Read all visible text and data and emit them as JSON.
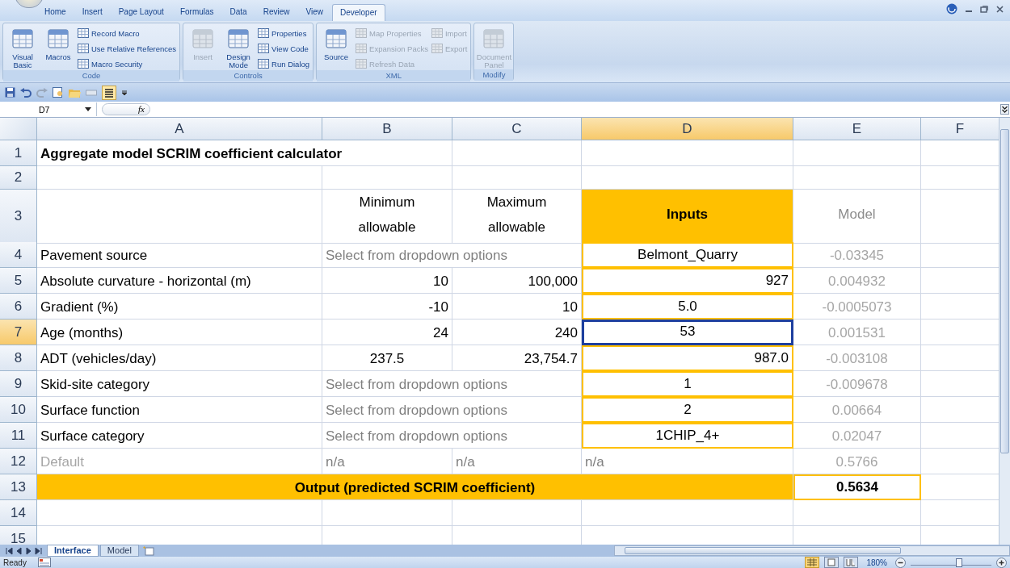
{
  "ribbon_tabs": [
    {
      "label": "Home",
      "selected": false
    },
    {
      "label": "Insert",
      "selected": false
    },
    {
      "label": "Page Layout",
      "selected": false
    },
    {
      "label": "Formulas",
      "selected": false
    },
    {
      "label": "Data",
      "selected": false
    },
    {
      "label": "Review",
      "selected": false
    },
    {
      "label": "View",
      "selected": false
    },
    {
      "label": "Developer",
      "selected": true
    }
  ],
  "ribbon_groups": [
    {
      "name": "Code",
      "items": [
        {
          "kind": "large",
          "label": "Visual Basic",
          "disabled": false
        },
        {
          "kind": "large",
          "label": "Macros",
          "disabled": false
        },
        {
          "kind": "small",
          "label": "Record Macro",
          "disabled": false
        },
        {
          "kind": "small",
          "label": "Use Relative References",
          "disabled": false
        },
        {
          "kind": "small",
          "label": "Macro Security",
          "disabled": false
        }
      ]
    },
    {
      "name": "Controls",
      "items": [
        {
          "kind": "large",
          "label": "Insert",
          "disabled": true
        },
        {
          "kind": "large",
          "label": "Design Mode",
          "disabled": false
        },
        {
          "kind": "small",
          "label": "Properties",
          "disabled": false
        },
        {
          "kind": "small",
          "label": "View Code",
          "disabled": false
        },
        {
          "kind": "small",
          "label": "Run Dialog",
          "disabled": false
        }
      ]
    },
    {
      "name": "XML",
      "items": [
        {
          "kind": "large",
          "label": "Source",
          "disabled": false
        },
        {
          "kind": "small",
          "label": "Map Properties",
          "disabled": true
        },
        {
          "kind": "small",
          "label": "Expansion Packs",
          "disabled": true
        },
        {
          "kind": "small",
          "label": "Refresh Data",
          "disabled": true
        },
        {
          "kind": "small",
          "label": "Import",
          "disabled": true
        },
        {
          "kind": "small",
          "label": "Export",
          "disabled": true
        }
      ]
    },
    {
      "name": "Modify",
      "items": [
        {
          "kind": "large",
          "label": "Document Panel",
          "disabled": true
        }
      ]
    }
  ],
  "formula_bar": {
    "name_box": "D7",
    "fx": "fx"
  },
  "columns": [
    {
      "label": "A",
      "selected": false
    },
    {
      "label": "B",
      "selected": false
    },
    {
      "label": "C",
      "selected": false
    },
    {
      "label": "D",
      "selected": true
    },
    {
      "label": "E",
      "selected": false
    },
    {
      "label": "F",
      "selected": false
    }
  ],
  "rows": [
    {
      "header": "1",
      "selected": false,
      "cells": {
        "A": {
          "kind": "title",
          "text": "Aggregate model SCRIM coefficient calculator",
          "selected": false
        }
      }
    },
    {
      "header": "2",
      "selected": false,
      "cells": {}
    },
    {
      "header": "3",
      "selected": false,
      "cells": {
        "B": {
          "kind": "heading",
          "text": "Minimum allowable",
          "selected": false
        },
        "C": {
          "kind": "heading",
          "text": "Maximum allowable",
          "selected": false
        },
        "D": {
          "kind": "input_heading",
          "text": "Inputs",
          "selected": false
        },
        "E": {
          "kind": "model_heading",
          "text": "Model",
          "selected": false
        }
      }
    },
    {
      "header": "4",
      "selected": false,
      "cells": {
        "A": {
          "kind": "label",
          "text": "Pavement source",
          "selected": false
        },
        "B": {
          "kind": "hint",
          "text": "Select from dropdown options",
          "selected": false
        },
        "D": {
          "kind": "input_center",
          "text": "Belmont_Quarry",
          "selected": false
        },
        "E": {
          "kind": "model",
          "text": "-0.03345",
          "selected": false
        }
      }
    },
    {
      "header": "5",
      "selected": false,
      "cells": {
        "A": {
          "kind": "label",
          "text": "Absolute curvature - horizontal (m)",
          "selected": false
        },
        "B": {
          "kind": "num",
          "text": "10",
          "selected": false
        },
        "C": {
          "kind": "num",
          "text": "100,000",
          "selected": false
        },
        "D": {
          "kind": "input_right",
          "text": "927",
          "selected": false
        },
        "E": {
          "kind": "model",
          "text": "0.004932",
          "selected": false
        }
      }
    },
    {
      "header": "6",
      "selected": false,
      "cells": {
        "A": {
          "kind": "label",
          "text": "Gradient (%)",
          "selected": false
        },
        "B": {
          "kind": "num",
          "text": "-10",
          "selected": false
        },
        "C": {
          "kind": "num",
          "text": "10",
          "selected": false
        },
        "D": {
          "kind": "input_center",
          "text": "5.0",
          "selected": false
        },
        "E": {
          "kind": "model",
          "text": "-0.0005073",
          "selected": false
        }
      }
    },
    {
      "header": "7",
      "selected": true,
      "cells": {
        "A": {
          "kind": "label",
          "text": "Age (months)",
          "selected": false
        },
        "B": {
          "kind": "num",
          "text": "24",
          "selected": false
        },
        "C": {
          "kind": "num",
          "text": "240",
          "selected": false
        },
        "D": {
          "kind": "input_center",
          "text": "53",
          "selected": true
        },
        "E": {
          "kind": "model",
          "text": "0.001531",
          "selected": false
        }
      }
    },
    {
      "header": "8",
      "selected": false,
      "cells": {
        "A": {
          "kind": "label",
          "text": "ADT (vehicles/day)",
          "selected": false
        },
        "B": {
          "kind": "num_center",
          "text": "237.5",
          "selected": false
        },
        "C": {
          "kind": "num",
          "text": "23,754.7",
          "selected": false
        },
        "D": {
          "kind": "input_right",
          "text": "987.0",
          "selected": false
        },
        "E": {
          "kind": "model",
          "text": "-0.003108",
          "selected": false
        }
      }
    },
    {
      "header": "9",
      "selected": false,
      "cells": {
        "A": {
          "kind": "label",
          "text": "Skid-site category",
          "selected": false
        },
        "B": {
          "kind": "hint",
          "text": "Select from dropdown options",
          "selected": false
        },
        "D": {
          "kind": "input_center",
          "text": "1",
          "selected": false
        },
        "E": {
          "kind": "model",
          "text": "-0.009678",
          "selected": false
        }
      }
    },
    {
      "header": "10",
      "selected": false,
      "cells": {
        "A": {
          "kind": "label",
          "text": "Surface function",
          "selected": false
        },
        "B": {
          "kind": "hint",
          "text": "Select from dropdown options",
          "selected": false
        },
        "D": {
          "kind": "input_center",
          "text": "2",
          "selected": false
        },
        "E": {
          "kind": "model",
          "text": "0.00664",
          "selected": false
        }
      }
    },
    {
      "header": "11",
      "selected": false,
      "cells": {
        "A": {
          "kind": "label",
          "text": "Surface category",
          "selected": false
        },
        "B": {
          "kind": "hint",
          "text": "Select from dropdown options",
          "selected": false
        },
        "D": {
          "kind": "input_center",
          "text": "1CHIP_4+",
          "selected": false
        },
        "E": {
          "kind": "model",
          "text": "0.02047",
          "selected": false
        }
      }
    },
    {
      "header": "12",
      "selected": false,
      "cells": {
        "A": {
          "kind": "muted_label",
          "text": "Default",
          "selected": false
        },
        "B": {
          "kind": "na",
          "text": "n/a",
          "selected": false
        },
        "C": {
          "kind": "na",
          "text": "n/a",
          "selected": false
        },
        "D": {
          "kind": "na",
          "text": "n/a",
          "selected": false
        },
        "E": {
          "kind": "model",
          "text": "0.5766",
          "selected": false
        }
      }
    },
    {
      "header": "13",
      "selected": false,
      "cells": {
        "A": {
          "kind": "output_label",
          "text": "Output (predicted SCRIM coefficient)",
          "selected": false
        },
        "E": {
          "kind": "output_value",
          "text": "0.5634",
          "selected": false
        }
      }
    },
    {
      "header": "14",
      "selected": false,
      "cells": {}
    },
    {
      "header": "15",
      "selected": false,
      "cells": {}
    }
  ],
  "sheet_tabs": [
    {
      "label": "Interface",
      "selected": true
    },
    {
      "label": "Model",
      "selected": false
    }
  ],
  "status_bar": {
    "status": "Ready",
    "zoom": "180%",
    "zoom_slider": {
      "level": 0.6
    }
  }
}
